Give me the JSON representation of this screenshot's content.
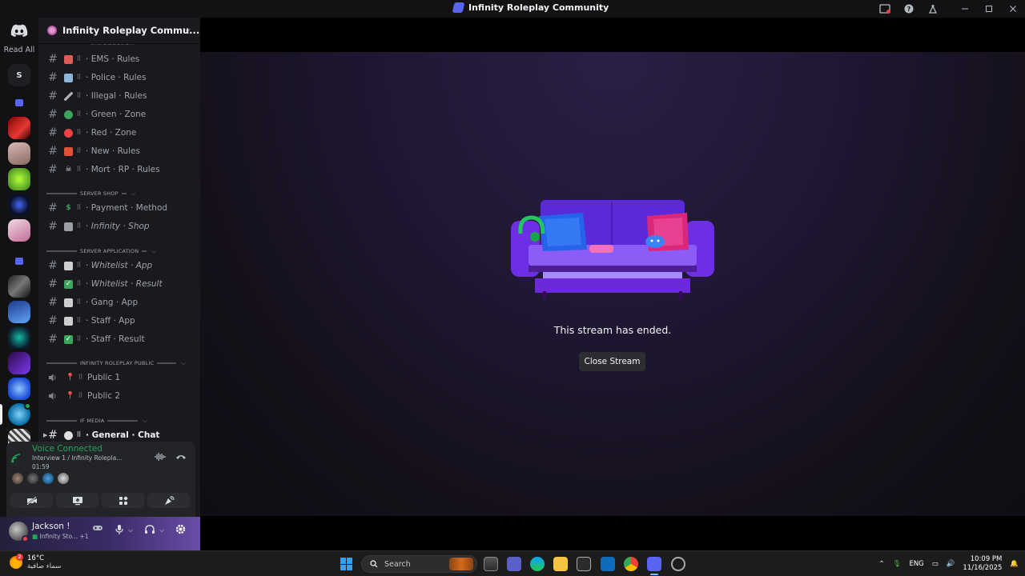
{
  "window": {
    "title": "Infinity Roleplay Community"
  },
  "guild_rail": {
    "read_all": "Read All",
    "letter_server": "S"
  },
  "server": {
    "name": "Infinity Roleplay Commu...",
    "cut_channel": "introduction"
  },
  "channels": [
    {
      "name": "· EMS · Rules",
      "emoji_color": "#e8e8e8"
    },
    {
      "name": "· Police · Rules",
      "emoji_color": "#8fb6d8"
    },
    {
      "name": "· Illegal · Rules",
      "emoji_color": "#b0b0b0"
    },
    {
      "name": "· Green · Zone",
      "emoji_color": "#3ba55c"
    },
    {
      "name": "· Red · Zone",
      "emoji_color": "#ed4245"
    },
    {
      "name": "· New · Rules",
      "emoji_color": "#e2503a"
    },
    {
      "name": "· Mort · RP · Rules",
      "emoji_color": "#dcdcdc"
    }
  ],
  "categories": {
    "shop": "SERVER SHOP",
    "application": "SERVER APPLICATION",
    "public": "INFINITY ROLEPLAY PUBLIC",
    "media": "IF MEDIA"
  },
  "shop_channels": [
    {
      "name": "· Payment · Method",
      "emoji": "$",
      "emoji_color": "#3ba55c",
      "italic": false
    },
    {
      "name": "Infinity · Shop",
      "prefix": "· ",
      "emoji_color": "#9aa0a6",
      "italic": true
    }
  ],
  "application_channels": [
    {
      "name": "Whitelist · App",
      "prefix": "· ",
      "emoji_color": "#cfcfcf",
      "italic": true
    },
    {
      "name": "Whitelist · Result",
      "prefix": "· ",
      "emoji_color": "#3ba55c",
      "italic": true
    },
    {
      "name": "· Gang · App",
      "emoji_color": "#cfcfcf",
      "italic": false
    },
    {
      "name": "· Staff · App",
      "emoji_color": "#cfcfcf",
      "italic": false
    },
    {
      "name": "· Staff · Result",
      "emoji_color": "#3ba55c",
      "italic": false
    }
  ],
  "voice_channels": [
    {
      "name": "Public 1"
    },
    {
      "name": "Public 2"
    }
  ],
  "media_channel": {
    "name": "· General · Chat"
  },
  "voice": {
    "status": "Voice Connected",
    "channel": "Interview 1 / Infinity Roleplа...",
    "elapsed": "01:59"
  },
  "user": {
    "name": "Jackson !",
    "activity": "Infinity Sto... +1"
  },
  "stage": {
    "message": "This stream has ended.",
    "close_label": "Close Stream"
  },
  "taskbar": {
    "temperature": "16°C",
    "weather_desc": "سماء صافية",
    "weather_badge": "2",
    "search_placeholder": "Search",
    "language": "ENG",
    "time": "10:09 PM",
    "date": "11/16/2025"
  },
  "colors": {
    "accent": "#5865f2",
    "voice_green": "#23a55a",
    "stage_bg": "#1f1733"
  }
}
